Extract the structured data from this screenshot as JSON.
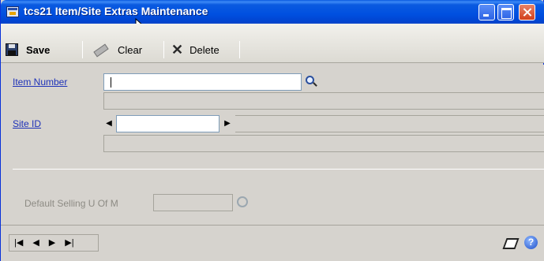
{
  "window": {
    "title": "tcs21 Item/Site Extras Maintenance"
  },
  "toolbar": {
    "save_label": "Save",
    "clear_label": "Clear",
    "delete_label": "Delete"
  },
  "form": {
    "item_number": {
      "label": "Item Number",
      "value": ""
    },
    "site_id": {
      "label": "Site ID",
      "value": ""
    },
    "default_selling_uofm": {
      "label": "Default Selling U Of M",
      "value": ""
    }
  },
  "statusbar": {
    "nav": [
      "|◀",
      "◀",
      "▶",
      "▶|"
    ]
  },
  "colors": {
    "titlebar": "#0a5ae0",
    "link_label": "#1e32b8",
    "disabled_label": "#8d8b84",
    "window_bg": "#d6d3ce"
  },
  "icons": {
    "title": "window-app-icon",
    "save": "floppy-disk-icon",
    "clear": "eraser-icon",
    "delete": "x-delete-icon",
    "lookup": "magnifier-lookup-icon",
    "note": "note-icon",
    "help": "help-icon"
  }
}
